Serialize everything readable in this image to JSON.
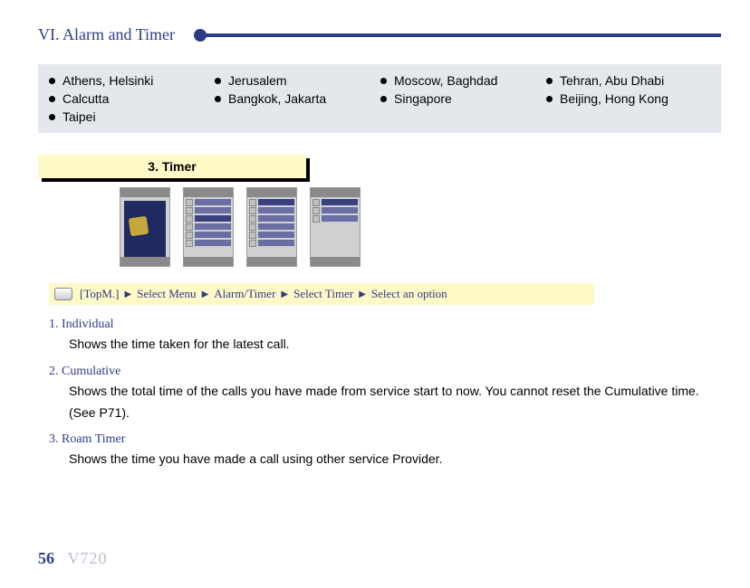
{
  "header": {
    "title": "VI. Alarm and Timer"
  },
  "cities": {
    "r1c1": "Athens, Helsinki",
    "r1c2": "Jerusalem",
    "r1c3": "Moscow, Baghdad",
    "r1c4": "Tehran, Abu Dhabi",
    "r2c1": "Calcutta",
    "r2c2": "Bangkok, Jakarta",
    "r2c3": "Singapore",
    "r2c4": "Beijing, Hong Kong",
    "r3c1": "Taipei"
  },
  "timer_tab": "3. Timer",
  "nav": {
    "top": "[TopM.]",
    "s1": "Select Menu",
    "s2": "Alarm/Timer",
    "s3": "Select Timer",
    "s4": "Select an option",
    "arrow": "▶"
  },
  "sections": {
    "t1": "1. Individual",
    "b1": "Shows the time taken for the latest call.",
    "t2": "2. Cumulative",
    "b2": "Shows the total time of the calls you have made from service start to now. You cannot reset the Cumulative time. (See P71).",
    "t3": "3. Roam Timer",
    "b3": "Shows the time you have made a call using other service Provider."
  },
  "footer": {
    "page": "56",
    "model": "V720"
  }
}
